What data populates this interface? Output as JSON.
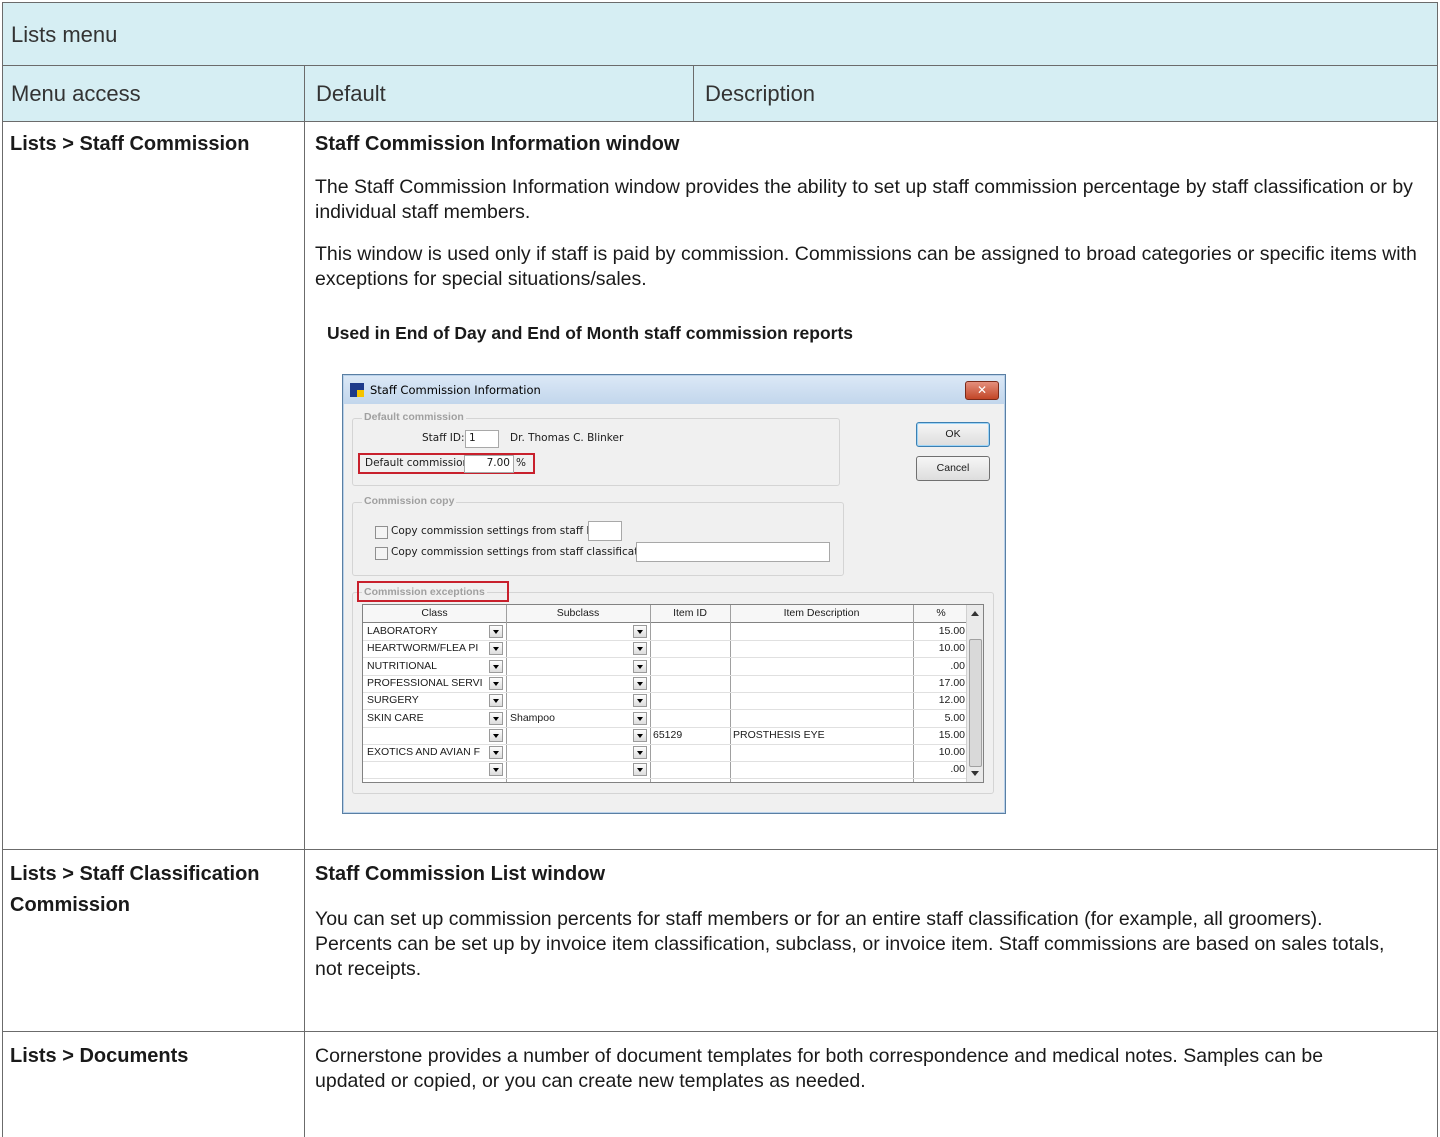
{
  "table": {
    "title": "Lists menu",
    "columns": [
      "Menu access",
      "Default",
      "Description"
    ],
    "rows": [
      {
        "menu_access": "Lists > Staff Commission",
        "heading": "Staff Commission Information window",
        "paragraphs": [
          "The Staff Commission Information window provides the ability to set up staff commission percentage by staff classification or by individual staff members.",
          "This window is used only if staff is paid by commission. Commissions can be assigned to broad categories or specific items with exceptions for special situations/sales."
        ],
        "note": "Used in End of Day and End of Month staff commission reports"
      },
      {
        "menu_access": "Lists > Staff Classification Commission",
        "heading": "Staff Commission List window",
        "paragraphs": [
          "You can set up commission percents for staff members or for an entire staff classification (for example, all groomers). Percents can be set up by invoice item classification, subclass, or invoice item. Staff commissions are based on sales totals, not receipts."
        ]
      },
      {
        "menu_access": "Lists > Documents",
        "paragraphs": [
          "Cornerstone provides a number of document templates for both correspondence and medical notes. Samples can be updated or copied, or you can create new templates as needed."
        ]
      }
    ]
  },
  "dialog": {
    "title": "Staff Commission Information",
    "close_glyph": "✕",
    "default_group": {
      "label": "Default commission",
      "staff_id_label": "Staff ID:",
      "staff_id_value": "1",
      "staff_name": "Dr. Thomas C. Blinker",
      "commission_label": "Default commission:",
      "commission_value": "7.00",
      "commission_unit": "%"
    },
    "buttons": {
      "ok": "OK",
      "cancel": "Cancel"
    },
    "copy_group": {
      "label": "Commission copy",
      "copy_staff_id": "Copy commission settings from staff ID:",
      "copy_classification": "Copy commission settings from staff classification:"
    },
    "exceptions": {
      "label": "Commission exceptions",
      "headers": [
        "Class",
        "Subclass",
        "Item ID",
        "Item Description",
        "%"
      ],
      "rows": [
        {
          "class": "LABORATORY",
          "subclass": "",
          "item_id": "",
          "description": "",
          "pct": "15.00"
        },
        {
          "class": "HEARTWORM/FLEA PI",
          "subclass": "",
          "item_id": "",
          "description": "",
          "pct": "10.00"
        },
        {
          "class": "NUTRITIONAL",
          "subclass": "",
          "item_id": "",
          "description": "",
          "pct": ".00"
        },
        {
          "class": "PROFESSIONAL SERVI",
          "subclass": "",
          "item_id": "",
          "description": "",
          "pct": "17.00"
        },
        {
          "class": "SURGERY",
          "subclass": "",
          "item_id": "",
          "description": "",
          "pct": "12.00"
        },
        {
          "class": "SKIN CARE",
          "subclass": "Shampoo",
          "item_id": "",
          "description": "",
          "pct": "5.00"
        },
        {
          "class": "",
          "subclass": "",
          "item_id": "65129",
          "description": "PROSTHESIS EYE",
          "pct": "15.00"
        },
        {
          "class": "EXOTICS AND AVIAN F",
          "subclass": "",
          "item_id": "",
          "description": "",
          "pct": "10.00"
        },
        {
          "class": "",
          "subclass": "",
          "item_id": "",
          "description": "",
          "pct": ".00"
        }
      ]
    }
  }
}
